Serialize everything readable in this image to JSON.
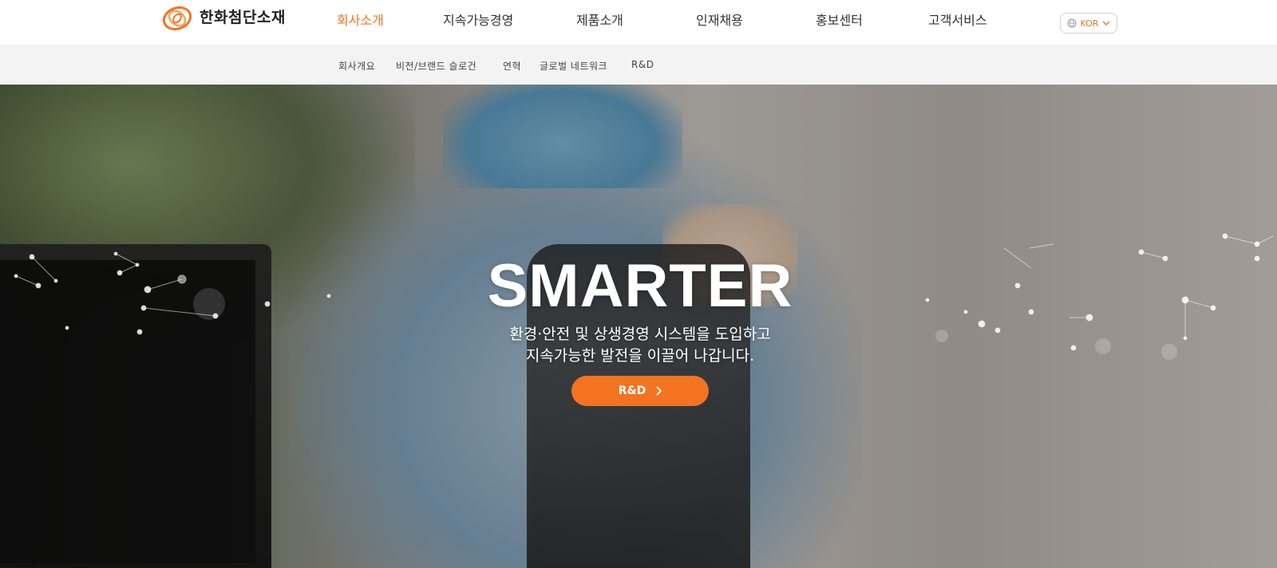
{
  "brand": {
    "name": "한화첨단소재",
    "logo_icon": "hanwha-logo-icon",
    "accent_color": "#f37321"
  },
  "gnb": {
    "items": [
      {
        "label": "회사소개",
        "active": true
      },
      {
        "label": "지속가능경영",
        "active": false
      },
      {
        "label": "제품소개",
        "active": false
      },
      {
        "label": "인재채용",
        "active": false
      },
      {
        "label": "홍보센터",
        "active": false
      },
      {
        "label": "고객서비스",
        "active": false
      }
    ]
  },
  "lang": {
    "label": "KOR",
    "icon": "globe-icon"
  },
  "subnav": {
    "items": [
      {
        "label": "회사개요"
      },
      {
        "label": "비전/브랜드 슬로건"
      },
      {
        "label": "연혁"
      },
      {
        "label": "글로벌 네트워크"
      },
      {
        "label": "R&D"
      }
    ]
  },
  "hero": {
    "title": "SMARTER",
    "desc_line1": "환경·안전 및 상생경영 시스템을 도입하고",
    "desc_line2": "지속가능한 발전을 이끌어 나갑니다.",
    "button_label": "R&D"
  }
}
